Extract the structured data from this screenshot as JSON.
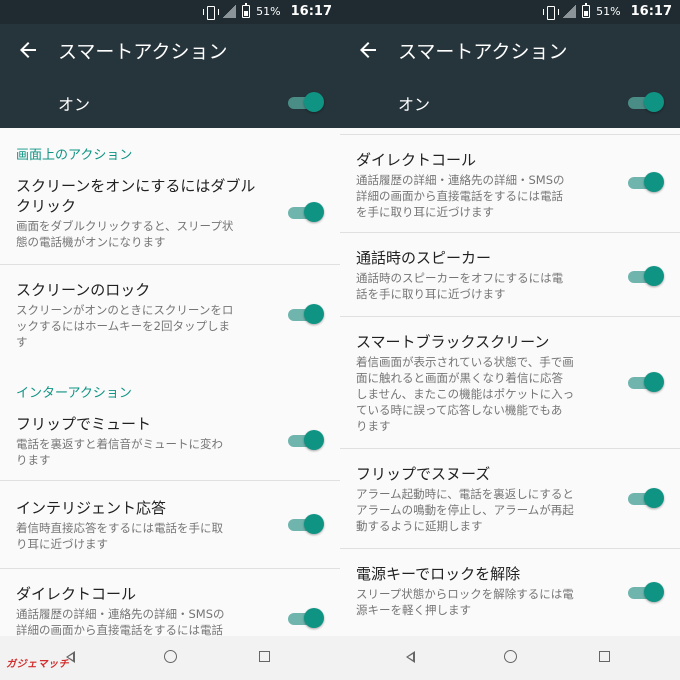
{
  "status": {
    "battery": "51%",
    "time": "16:17"
  },
  "appbar": {
    "title": "スマートアクション"
  },
  "master": {
    "label": "オン",
    "on": true
  },
  "left": {
    "section1": "画面上のアクション",
    "section2": "インターアクション",
    "items": [
      {
        "title": "スクリーンをオンにするにはダブル\nクリック",
        "desc": "画面をダブルクリックすると、スリープ状\n態の電話機がオンになります"
      },
      {
        "title": "スクリーンのロック",
        "desc": "スクリーンがオンのときにスクリーンをロ\nックするにはホームキーを2回タップしま\nす"
      },
      {
        "title": "フリップでミュート",
        "desc": "電話を裏返すと着信音がミュートに変わ\nります"
      },
      {
        "title": "インテリジェント応答",
        "desc": "着信時直接応答をするには電話を手に取\nり耳に近づけます"
      },
      {
        "title": "ダイレクトコール",
        "desc": "通話履歴の詳細・連絡先の詳細・SMSの\n詳細の画面から直接電話をするには電話"
      }
    ]
  },
  "right": {
    "items": [
      {
        "title": "ダイレクトコール",
        "desc": "通話履歴の詳細・連絡先の詳細・SMSの\n詳細の画面から直接電話をするには電話\nを手に取り耳に近づけます"
      },
      {
        "title": "通話時のスピーカー",
        "desc": "通話時のスピーカーをオフにするには電\n話を手に取り耳に近づけます"
      },
      {
        "title": "スマートブラックスクリーン",
        "desc": "着信画面が表示されている状態で、手で画\n面に触れると画面が黒くなり着信に応答\nしません、またこの機能はポケットに入っ\nている時に誤って応答しない機能でもあ\nります"
      },
      {
        "title": "フリップでスヌーズ",
        "desc": "アラーム起動時に、電話を裏返しにすると\nアラームの鳴動を停止し、アラームが再起\n動するように延期します"
      },
      {
        "title": "電源キーでロックを解除",
        "desc": "スリープ状態からロックを解除するには電\n源キーを軽く押します"
      }
    ]
  },
  "watermark": "ガジェマッチ",
  "colors": {
    "accent": "#0f9484",
    "appbar": "#26343b",
    "statusbar": "#1f2b31"
  }
}
